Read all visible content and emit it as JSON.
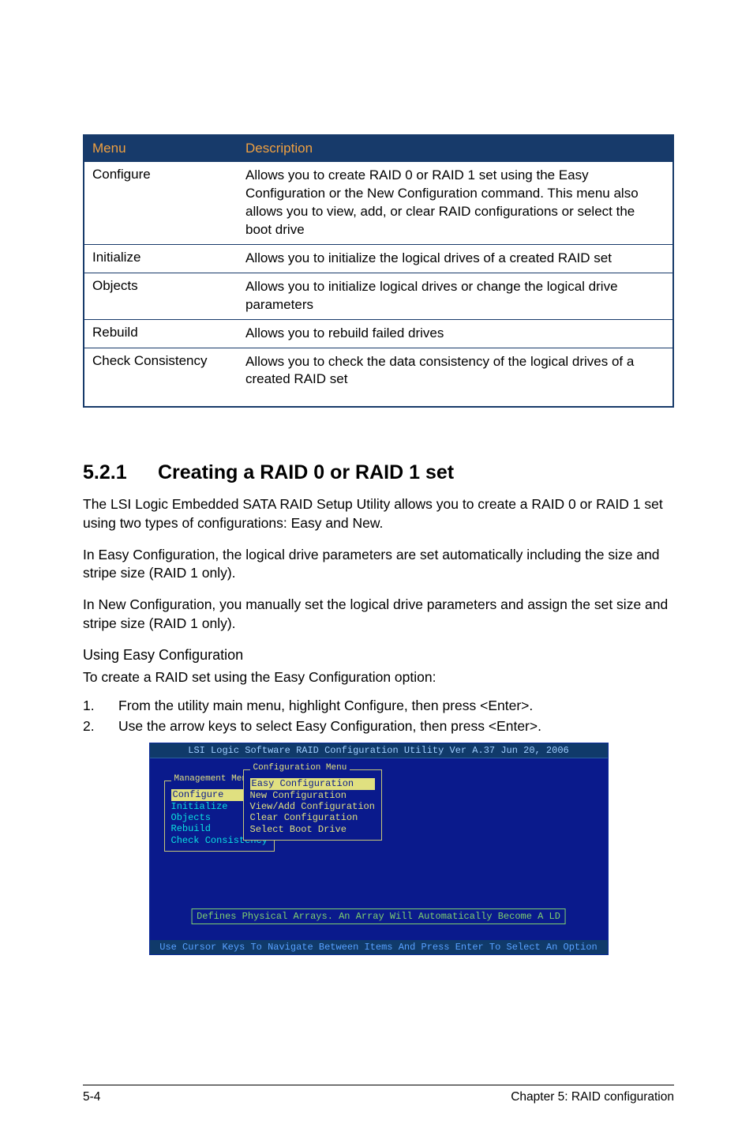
{
  "table": {
    "headers": {
      "menu": "Menu",
      "description": "Description"
    },
    "rows": [
      {
        "menu": "Configure",
        "description": "Allows you to create RAID 0 or RAID 1 set using the Easy Configuration or the New Configuration command. This menu also allows you to view, add, or clear RAID configurations or select the boot drive"
      },
      {
        "menu": "Initialize",
        "description": "Allows you to initialize the logical drives of a created RAID set"
      },
      {
        "menu": "Objects",
        "description": "Allows you to initialize logical drives or change the logical drive parameters"
      },
      {
        "menu": "Rebuild",
        "description": "Allows you to rebuild failed drives"
      },
      {
        "menu": "Check Consistency",
        "description": "Allows you to check the data consistency of the logical drives of a created RAID set"
      }
    ]
  },
  "section": {
    "number": "5.2.1",
    "title": "Creating a RAID 0 or RAID 1 set"
  },
  "paragraphs": {
    "p1": "The LSI Logic Embedded SATA RAID Setup Utility allows you to create a RAID 0 or RAID 1 set using two types of configurations: Easy and New.",
    "p2": "In Easy Configuration, the logical drive parameters are set automatically including the size and stripe size (RAID 1 only).",
    "p3": "In New Configuration, you manually set the logical drive parameters and assign the set size and stripe size (RAID 1 only)."
  },
  "subheading": "Using Easy Configuration",
  "subpara": "To create a RAID set using the Easy Configuration option:",
  "steps": [
    {
      "n": "1.",
      "t": "From the utility main menu, highlight Configure, then press <Enter>."
    },
    {
      "n": "2.",
      "t": "Use the arrow keys to select Easy Configuration, then press <Enter>."
    }
  ],
  "bios": {
    "titlebar": "LSI Logic Software RAID Configuration Utility Ver A.37 Jun 20, 2006",
    "mgmt_label": "Management Menu",
    "mgmt_items": [
      "Configure",
      "Initialize",
      "Objects",
      "Rebuild",
      "Check Consistency"
    ],
    "conf_label": "Configuration Menu",
    "conf_items": [
      "Easy Configuration",
      "New Configuration",
      "View/Add Configuration",
      "Clear Configuration",
      "Select Boot Drive"
    ],
    "hint": "Defines Physical Arrays. An Array Will Automatically Become A LD",
    "footer": "Use Cursor Keys To Navigate Between Items And Press Enter To Select An Option"
  },
  "footer": {
    "left": "5-4",
    "right": "Chapter 5: RAID configuration"
  }
}
